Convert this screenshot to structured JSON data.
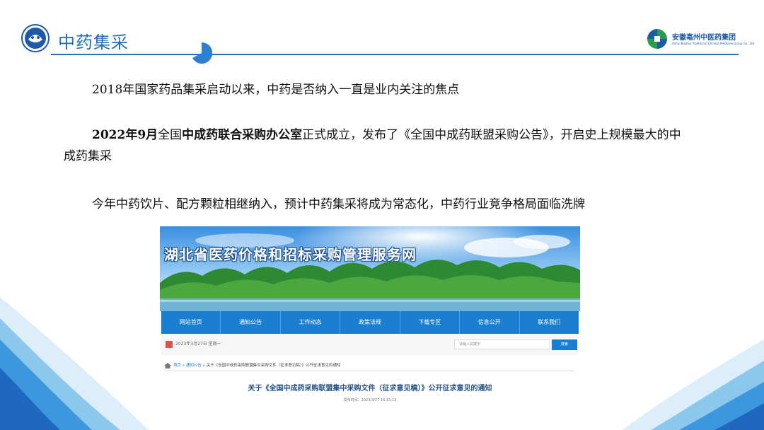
{
  "header": {
    "title": "中药集采",
    "brand_cn": "安徽亳州中医药集团",
    "brand_en": "Anhui Bozhou Traditional Chinese Medicine Group Co., Ltd"
  },
  "paragraphs": {
    "p1": "2018年国家药品集采启动以来，中药是否纳入一直是业内关注的焦点",
    "p2_year": "2022年9月",
    "p2_a": "全国",
    "p2_office": "中成药联合采购办公室",
    "p2_b": "正式成立，发布了《全国中成药联盟采购公告》，开启史上规模最大的中成药集采",
    "p3": "今年中药饮片、配方颗粒相继纳入，预计中药集采将成为常态化，中药行业竞争格局面临洗牌"
  },
  "screenshot": {
    "banner_title": "湖北省医药价格和招标采购管理服务网",
    "nav": [
      "网站首页",
      "通知公告",
      "工作动态",
      "政策法规",
      "下载专区",
      "信息公开",
      "联系我们"
    ],
    "date": "2023年3月27日 星期一",
    "search_placeholder": "请输入关键字",
    "search_button": "搜索",
    "crumb_home": "首页",
    "crumb_sep": " » ",
    "crumb_notice": "通知公告",
    "crumb_current": "关于《全国中成药采购联盟集中采购文件（征求意见稿）》公开征求意见的通知",
    "notice_title": "关于《全国中成药采购联盟集中采购文件（征求意见稿）》公开征求意见的通知",
    "notice_date": "发布时间：2023/3/27 16:15:13"
  },
  "colors": {
    "accent": "#1f6fc2",
    "nav_bg": "#1b7fd1"
  }
}
